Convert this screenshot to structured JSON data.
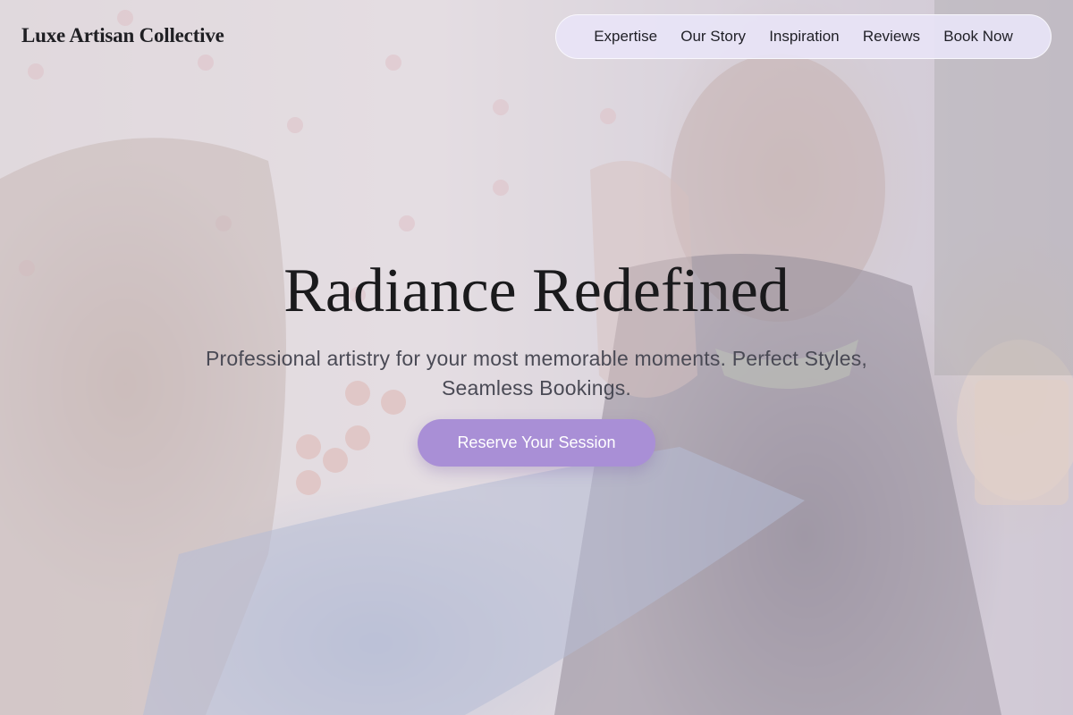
{
  "brand": {
    "name": "Luxe Artisan Collective"
  },
  "nav": {
    "items": [
      {
        "label": "Expertise"
      },
      {
        "label": "Our Story"
      },
      {
        "label": "Inspiration"
      },
      {
        "label": "Reviews"
      },
      {
        "label": "Book Now"
      }
    ]
  },
  "hero": {
    "title": "Radiance Redefined",
    "subtitle": "Professional artistry for your most memorable moments. Perfect Styles, Seamless Bookings.",
    "cta_label": "Reserve Your Session"
  },
  "colors": {
    "accent": "#a98fd6",
    "nav_bg": "#e8e4f6",
    "text_dark": "#1a1a1c",
    "text_muted": "#4a4a55"
  }
}
